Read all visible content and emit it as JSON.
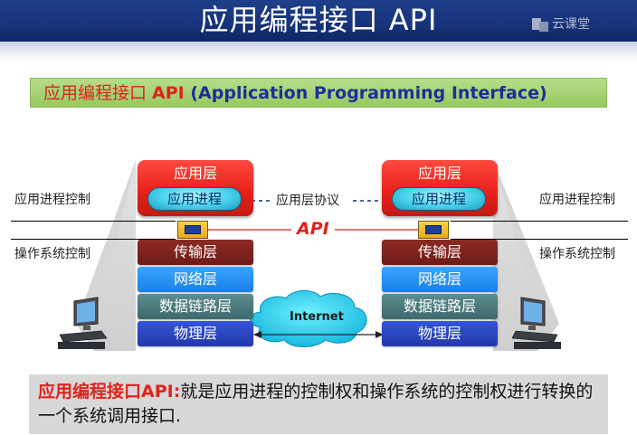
{
  "header": {
    "title": "应用编程接口 API",
    "logo_text": "云课堂"
  },
  "subtitle": {
    "zh": "应用编程接口 ",
    "api": "API",
    "en": " (Application Programming Interface)"
  },
  "diagram": {
    "left": {
      "process_control": "应用进程控制",
      "os_control": "操作系统控制"
    },
    "right": {
      "process_control": "应用进程控制",
      "os_control": "操作系统控制"
    },
    "app_layer": "应用层",
    "app_process": "应用进程",
    "protocol_label": "应用层协议",
    "api_label": "API",
    "layers": [
      "传输层",
      "网络层",
      "数据链路层",
      "物理层"
    ],
    "cloud_label": "Internet",
    "colors": {
      "app_layer": "#e8221a",
      "transport": "#7a201c",
      "network": "#2a8cf0",
      "datalink": "#4a7a7c",
      "physical": "#2a44c0",
      "api": "#e0221c"
    }
  },
  "definition": {
    "term": "应用编程接口API:",
    "text": "就是应用进程的控制权和操作系统的控制权进行转换的一个系统调用接口."
  }
}
